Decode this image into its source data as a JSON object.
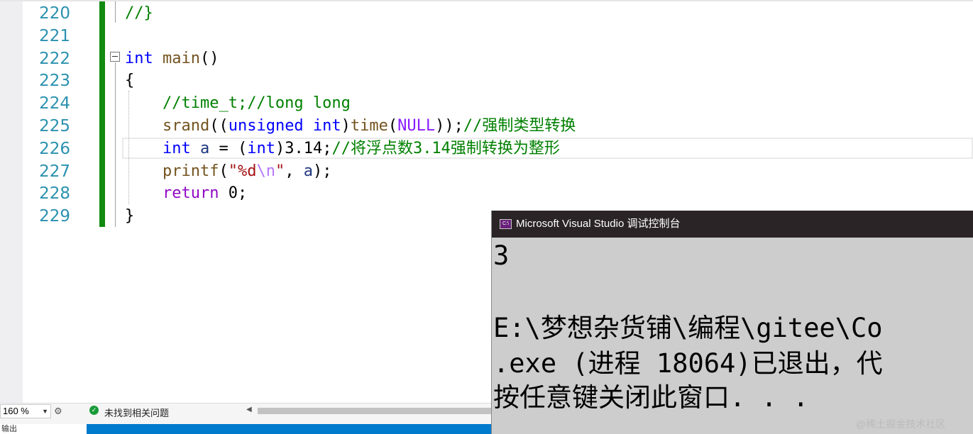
{
  "editor": {
    "lines": [
      {
        "num": "220",
        "parts": [
          {
            "t": "//}",
            "c": "cm"
          }
        ]
      },
      {
        "num": "221",
        "parts": []
      },
      {
        "num": "222",
        "parts": [
          {
            "t": "int",
            "c": "kw"
          },
          {
            "t": " ",
            "c": "pu"
          },
          {
            "t": "main",
            "c": "fn"
          },
          {
            "t": "()",
            "c": "pu"
          }
        ]
      },
      {
        "num": "223",
        "parts": [
          {
            "t": "{",
            "c": "pu"
          }
        ]
      },
      {
        "num": "224",
        "parts": [
          {
            "t": "    ",
            "c": "pu"
          },
          {
            "t": "//time_t;//long long",
            "c": "cm"
          }
        ]
      },
      {
        "num": "225",
        "parts": [
          {
            "t": "    ",
            "c": "pu"
          },
          {
            "t": "srand",
            "c": "fn"
          },
          {
            "t": "((",
            "c": "pu"
          },
          {
            "t": "unsigned int",
            "c": "kw"
          },
          {
            "t": ")",
            "c": "pu"
          },
          {
            "t": "time",
            "c": "fn"
          },
          {
            "t": "(",
            "c": "pu"
          },
          {
            "t": "NULL",
            "c": "mc"
          },
          {
            "t": "));",
            "c": "pu"
          },
          {
            "t": "//强制类型转换",
            "c": "cm"
          }
        ]
      },
      {
        "num": "226",
        "parts": [
          {
            "t": "    ",
            "c": "pu"
          },
          {
            "t": "int",
            "c": "kw"
          },
          {
            "t": " ",
            "c": "pu"
          },
          {
            "t": "a",
            "c": "var"
          },
          {
            "t": " = (",
            "c": "pu"
          },
          {
            "t": "int",
            "c": "kw"
          },
          {
            "t": ")3.14;",
            "c": "pu"
          },
          {
            "t": "//将浮点数3.14强制转换为整形",
            "c": "cm"
          }
        ]
      },
      {
        "num": "227",
        "parts": [
          {
            "t": "    ",
            "c": "pu"
          },
          {
            "t": "printf",
            "c": "fn"
          },
          {
            "t": "(",
            "c": "pu"
          },
          {
            "t": "\"%d",
            "c": "st"
          },
          {
            "t": "\\n",
            "c": "esc"
          },
          {
            "t": "\"",
            "c": "st"
          },
          {
            "t": ", ",
            "c": "pu"
          },
          {
            "t": "a",
            "c": "var"
          },
          {
            "t": ");",
            "c": "pu"
          }
        ]
      },
      {
        "num": "228",
        "parts": [
          {
            "t": "    ",
            "c": "pu"
          },
          {
            "t": "return",
            "c": "ctl"
          },
          {
            "t": " 0;",
            "c": "pu"
          }
        ]
      },
      {
        "num": "229",
        "parts": [
          {
            "t": "}",
            "c": "pu"
          }
        ]
      }
    ]
  },
  "statusbar": {
    "zoom": "160 %",
    "issues_text": "未找到相关问题"
  },
  "output_tab": {
    "label": "输出"
  },
  "console": {
    "title": "Microsoft Visual Studio 调试控制台",
    "icon_text": "C:\\",
    "lines": [
      "3",
      "",
      "E:\\梦想杂货铺\\编程\\gitee\\Co",
      ".exe (进程 18064)已退出，代",
      "按任意键关闭此窗口. . ."
    ]
  },
  "watermark": "@稀土掘金技术社区",
  "colors": {
    "change_bar": "#108a10",
    "line_number": "#2b91af",
    "keyword": "#0000ff",
    "comment": "#008000",
    "console_title_bg": "#2b2426",
    "console_bg": "#cdcdcd",
    "status_ok": "#1a9b3a"
  }
}
